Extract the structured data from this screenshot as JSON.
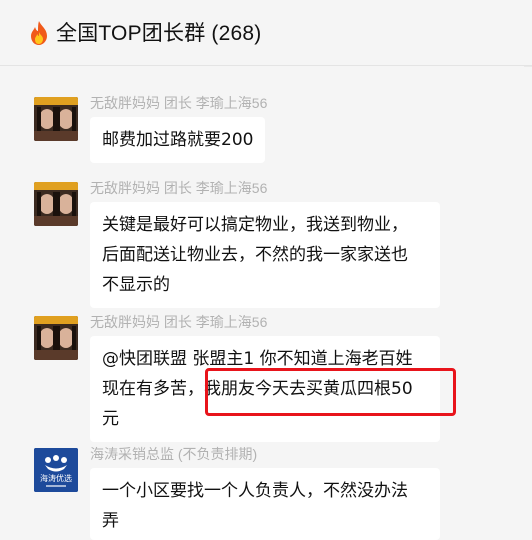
{
  "header": {
    "title": "全国TOP团长群 (268)",
    "icon": "fire-icon"
  },
  "messages": [
    {
      "sender": "无敌胖妈妈  团长  李瑜上海56",
      "avatar": "girl-photo-avatar",
      "lines": [
        "邮费加过路就要200"
      ]
    },
    {
      "sender": "无敌胖妈妈  团长  李瑜上海56",
      "avatar": "girl-photo-avatar",
      "lines": [
        "关键是最好可以搞定物业，我送到物业，",
        "后面配送让物业去，不然的我一家家送也",
        "不显示的"
      ]
    },
    {
      "sender": "无敌胖妈妈  团长  李瑜上海56",
      "avatar": "girl-photo-avatar",
      "lines": [
        "@快团联盟 张盟主1 你不知道上海老百姓",
        "现在有多苦，我朋友今天去买黄瓜四根50",
        "元"
      ],
      "highlighted": true
    },
    {
      "sender": "海涛采销总监  (不负责排期)",
      "avatar": "haitao-logo-avatar",
      "avatar_text": "海涛优选",
      "lines": [
        "一个小区要找一个人负责人，不然没办法",
        "弄"
      ]
    }
  ],
  "colors": {
    "highlight": "#e8141b",
    "logo_bg": "#1d4a9b"
  }
}
